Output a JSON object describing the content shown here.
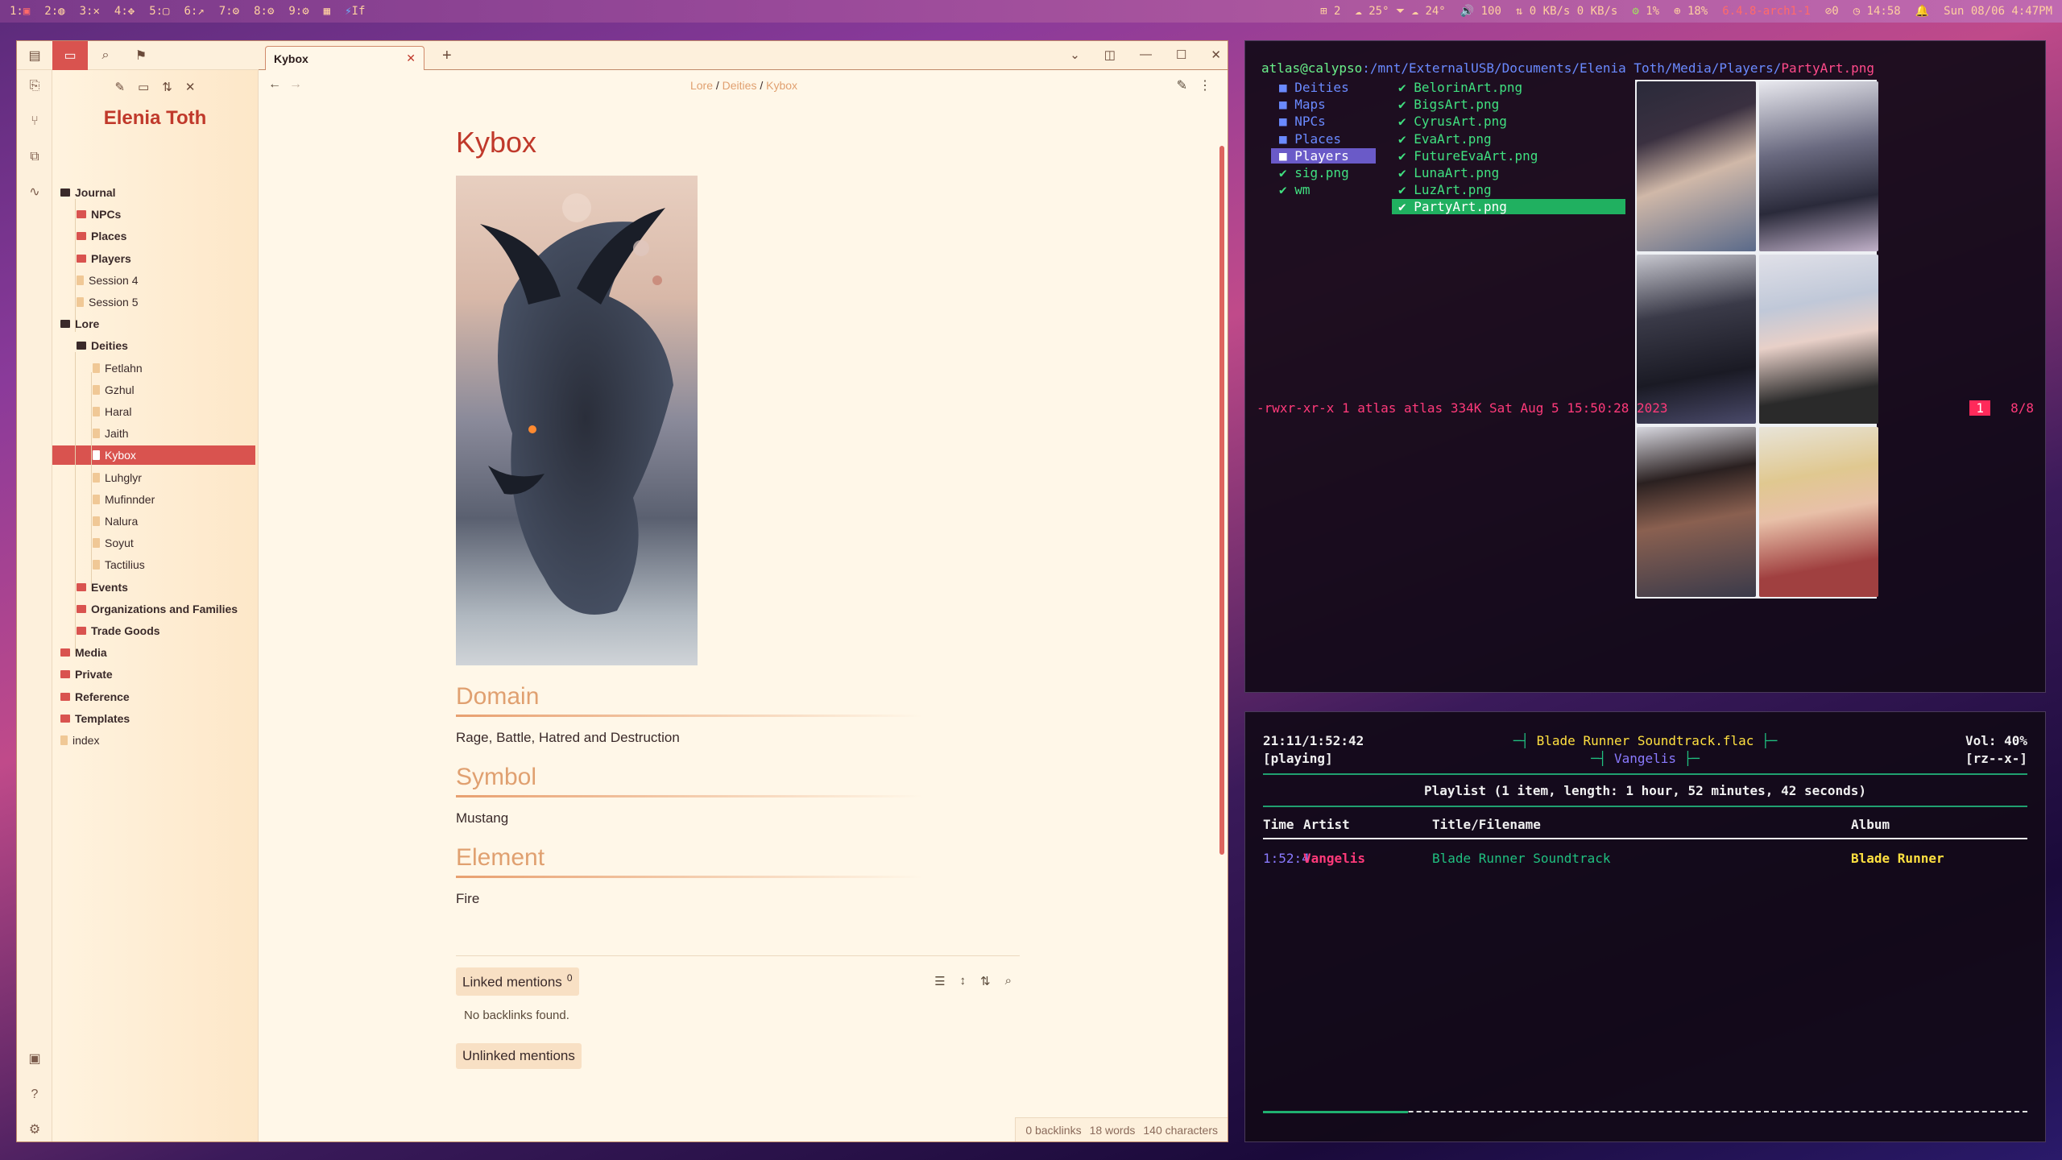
{
  "topbar": {
    "workspaces": [
      "1:",
      "2:",
      "3:",
      "4:",
      "5:",
      "6:",
      "7:",
      "8:",
      "9:"
    ],
    "extra": "If",
    "status": {
      "updates": "2",
      "weather1": "25°",
      "weather2": "24°",
      "volume": "100",
      "net": "0 KB/s  0 KB/s",
      "cpu": "1%",
      "mem": "18%",
      "kernel": "6.4.8-arch1-1",
      "notifications": "0",
      "clock": "14:58",
      "date": "Sun 08/06  4:47PM"
    }
  },
  "obsidian": {
    "vault_name": "Elenia Toth",
    "tab_title": "Kybox",
    "breadcrumb": [
      "Lore",
      "Deities",
      "Kybox"
    ],
    "tree": [
      {
        "label": "Journal",
        "type": "root"
      },
      {
        "label": "NPCs",
        "type": "folder"
      },
      {
        "label": "Places",
        "type": "folder"
      },
      {
        "label": "Players",
        "type": "folder"
      },
      {
        "label": "Session 4",
        "type": "file"
      },
      {
        "label": "Session 5",
        "type": "file"
      },
      {
        "label": "Lore",
        "type": "root"
      },
      {
        "label": "Deities",
        "type": "root"
      },
      {
        "label": "Fetlahn",
        "type": "file"
      },
      {
        "label": "Gzhul",
        "type": "file"
      },
      {
        "label": "Haral",
        "type": "file"
      },
      {
        "label": "Jaith",
        "type": "file"
      },
      {
        "label": "Kybox",
        "type": "file",
        "selected": true
      },
      {
        "label": "Luhglyr",
        "type": "file"
      },
      {
        "label": "Mufinnder",
        "type": "file"
      },
      {
        "label": "Nalura",
        "type": "file"
      },
      {
        "label": "Soyut",
        "type": "file"
      },
      {
        "label": "Tactilius",
        "type": "file"
      },
      {
        "label": "Events",
        "type": "folder"
      },
      {
        "label": "Organizations and Families",
        "type": "folder"
      },
      {
        "label": "Trade Goods",
        "type": "folder"
      },
      {
        "label": "Media",
        "type": "folder"
      },
      {
        "label": "Private",
        "type": "folder"
      },
      {
        "label": "Reference",
        "type": "folder"
      },
      {
        "label": "Templates",
        "type": "folder"
      },
      {
        "label": "index",
        "type": "file"
      }
    ],
    "note": {
      "title": "Kybox",
      "sections": [
        {
          "heading": "Domain",
          "text": "Rage, Battle, Hatred and Destruction"
        },
        {
          "heading": "Symbol",
          "text": "Mustang"
        },
        {
          "heading": "Element",
          "text": "Fire"
        }
      ]
    },
    "linked_mentions": "Linked mentions",
    "linked_count": "0",
    "no_backlinks": "No backlinks found.",
    "unlinked_mentions": "Unlinked mentions",
    "status": {
      "backlinks": "0 backlinks",
      "words": "18 words",
      "chars": "140 characters"
    }
  },
  "ranger": {
    "prompt_user": "atlas@calypso",
    "prompt_path": ":/mnt/ExternalUSB/Documents/Elenia Toth/Media/Players/",
    "prompt_file": "PartyArt.png",
    "col1": [
      {
        "label": "Deities",
        "kind": "dir"
      },
      {
        "label": "Maps",
        "kind": "dir"
      },
      {
        "label": "NPCs",
        "kind": "dir"
      },
      {
        "label": "Places",
        "kind": "dir"
      },
      {
        "label": "Players",
        "kind": "dir",
        "selected": true
      },
      {
        "label": "sig.png",
        "kind": "file"
      },
      {
        "label": "wm",
        "kind": "file"
      }
    ],
    "col2": [
      "BelorinArt.png",
      "BigsArt.png",
      "CyrusArt.png",
      "EvaArt.png",
      "FutureEvaArt.png",
      "LunaArt.png",
      "LuzArt.png",
      "PartyArt.png"
    ],
    "file_info": "-rwxr-xr-x 1 atlas atlas 334K Sat Aug  5 15:50:28 2023",
    "tab_num": "1",
    "position": "8/8"
  },
  "ncmpcpp": {
    "time": "21:11/1:52:42",
    "state": "[playing]",
    "title": "Blade Runner Soundtrack.flac",
    "artist": "Vangelis",
    "volume": "Vol: 40%",
    "flags": "[rz--x-]",
    "playlist_header": "Playlist (1 item, length: 1 hour, 52 minutes, 42 seconds)",
    "columns": [
      "Time",
      "Artist",
      "Title/Filename",
      "Album"
    ],
    "rows": [
      {
        "time": "1:52:4",
        "artist": "Vangelis",
        "title": "Blade Runner Soundtrack",
        "album": "Blade Runner"
      }
    ],
    "progress": 0.19
  }
}
